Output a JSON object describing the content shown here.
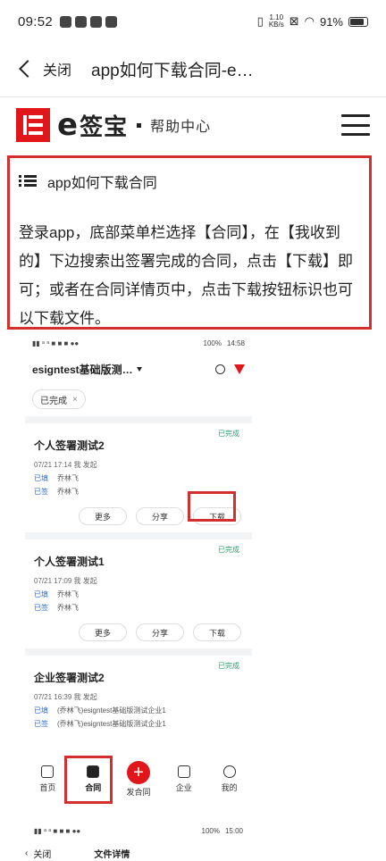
{
  "status_bar": {
    "time": "09:52",
    "net_speed_top": "1.10",
    "net_speed_bottom": "KB/s",
    "battery": "91%"
  },
  "nav": {
    "close": "关闭",
    "title": "app如何下载合同-e…"
  },
  "header": {
    "brand_name": "签宝",
    "help_center": "帮助中心"
  },
  "article": {
    "heading": "app如何下载合同",
    "body": "登录app，底部菜单栏选择【合同】，在【我收到的】下边搜索出签署完成的合同，点击【下载】即可；或者在合同详情页中，点击下载按钮标识也可以下载文件。"
  },
  "screenshot": {
    "status_time": "14:58",
    "status_battery": "100%",
    "account": "esigntest基础版测…",
    "chip": "已完成",
    "cards": [
      {
        "badge": "已完成",
        "title": "个人签署测试2",
        "meta": "07/21 17:14 我  发起",
        "lines": [
          {
            "role": "已填",
            "name": "乔林飞"
          },
          {
            "role": "已签",
            "name": "乔林飞"
          }
        ],
        "actions": [
          "更多",
          "分享",
          "下载"
        ]
      },
      {
        "badge": "已完成",
        "title": "个人签署测试1",
        "meta": "07/21 17:09 我  发起",
        "lines": [
          {
            "role": "已填",
            "name": "乔林飞"
          },
          {
            "role": "已签",
            "name": "乔林飞"
          }
        ],
        "actions": [
          "更多",
          "分享",
          "下载"
        ]
      },
      {
        "badge": "已完成",
        "title": "企业签署测试2",
        "meta": "07/21 16:39 我  发起",
        "lines": [
          {
            "role": "已填",
            "name": "(乔林飞)esigntest基础版测试企业1"
          },
          {
            "role": "已签",
            "name": "(乔林飞)esigntest基础版测试企业1"
          }
        ],
        "actions": []
      }
    ],
    "tabs": [
      "首页",
      "合同",
      "发合同",
      "企业",
      "我的"
    ],
    "status2_time": "15:00",
    "status2_battery": "100%",
    "nav2_close": "关闭",
    "nav2_title": "文件详情"
  },
  "colors": {
    "accent_red": "#e0161b",
    "highlight_border": "#d32f2f",
    "done_green": "#2e9e6b"
  }
}
